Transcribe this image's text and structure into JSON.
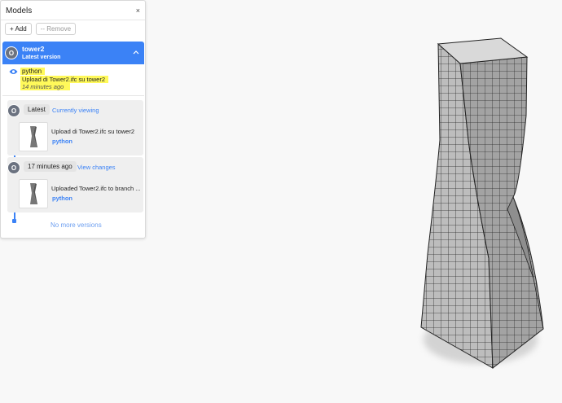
{
  "panel": {
    "title": "Models",
    "close_label": "×",
    "add_label": "+ Add",
    "remove_label": "-- Remove"
  },
  "model": {
    "avatar_initial": "O",
    "name": "tower2",
    "subtitle": "Latest version",
    "current": {
      "author": "python",
      "message": "Upload di Tower2.ifc su tower2",
      "time": "14 minutes ago"
    }
  },
  "versions": [
    {
      "avatar_initial": "O",
      "tag": "Latest",
      "link": "Currently viewing",
      "message": "Upload di Tower2.ifc su tower2",
      "author": "python"
    },
    {
      "avatar_initial": "O",
      "tag": "17 minutes ago",
      "link": "View changes",
      "message": "Uploaded Tower2.ifc to branch ...",
      "author": "python"
    }
  ],
  "footer": {
    "no_more": "No more versions"
  },
  "colors": {
    "accent": "#3b82f6",
    "highlight": "#fff95a",
    "avatar": "#6b7280"
  }
}
